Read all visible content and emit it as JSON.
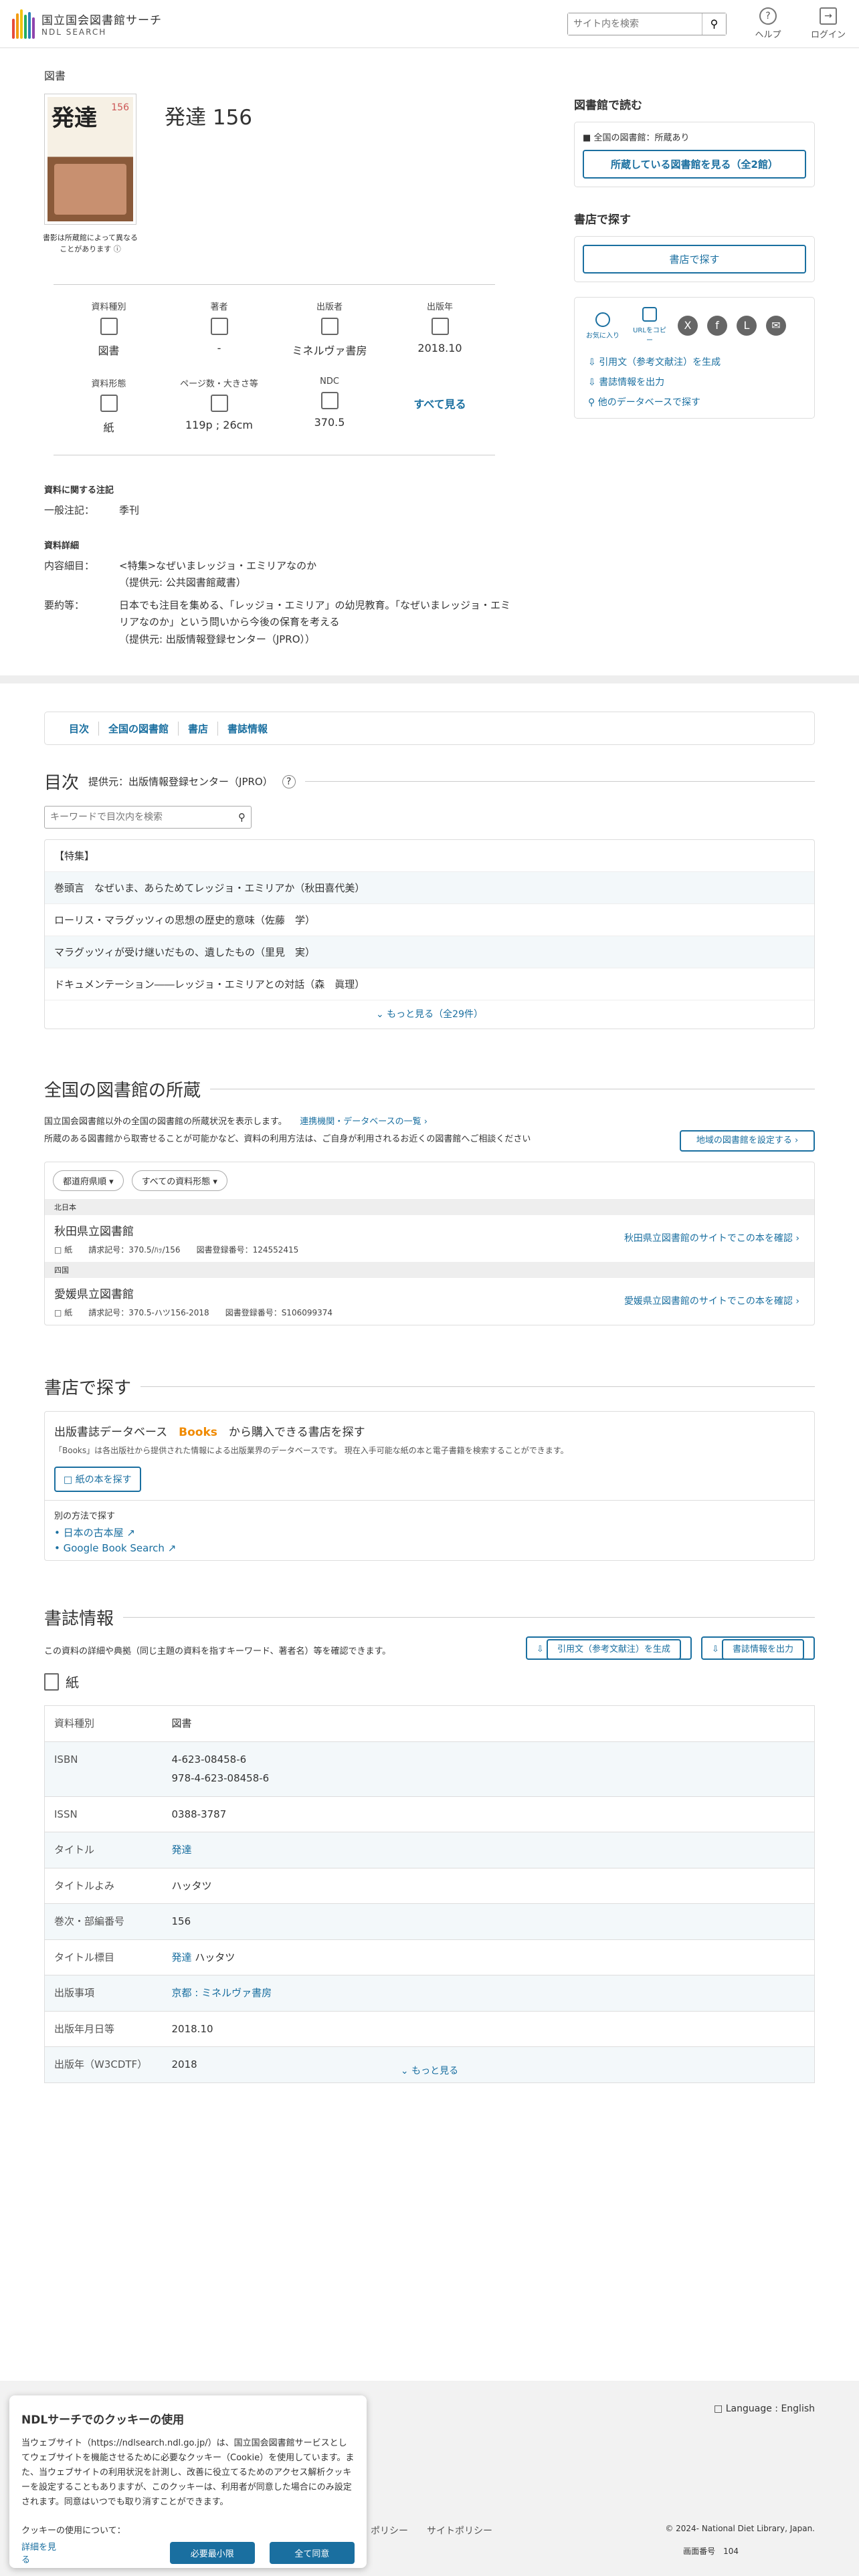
{
  "header": {
    "logo_line1": "国立国会図書館サーチ",
    "logo_line2": "NDL SEARCH",
    "search_placeholder": "サイト内を検索",
    "help": "ヘルプ",
    "login": "ログイン"
  },
  "item": {
    "doc_type_label": "図書",
    "title": "発達 156",
    "cover_title": "発達",
    "cover_num": "156",
    "cover_note": "書影は所蔵館によって異なることがあります"
  },
  "meta": [
    {
      "label": "資料種別",
      "value": "図書"
    },
    {
      "label": "著者",
      "value": "-"
    },
    {
      "label": "出版者",
      "value": "ミネルヴァ書房"
    },
    {
      "label": "出版年",
      "value": "2018.10"
    },
    {
      "label": "資料形態",
      "value": "紙"
    },
    {
      "label": "ページ数・大きさ等",
      "value": "119p ; 26cm"
    },
    {
      "label": "NDC",
      "value": "370.5"
    }
  ],
  "see_all": "すべて見る",
  "notes": {
    "heading": "資料に関する注記",
    "general_label": "一般注記：",
    "general_value": "季刊"
  },
  "details": {
    "heading": "資料詳細",
    "contents_label": "内容細目：",
    "contents_value": "<特集>なぜいまレッジョ・エミリアなのか",
    "contents_provider": "（提供元: 公共図書館蔵書）",
    "summary_label": "要約等：",
    "summary_value": "日本でも注目を集める、「レッジョ・エミリア」の幼児教育。「なぜいまレッジョ・エミリアなのか」という問いから今後の保育を考える",
    "summary_provider": "（提供元: 出版情報登録センター（JPRO））"
  },
  "side": {
    "library_heading": "図書館で読む",
    "nationwide": "全国の図書館：所蔵あり",
    "library_btn": "所蔵している図書館を見る（全2館）",
    "shop_heading": "書店で探す",
    "shop_btn": "書店で探す",
    "favorite": "お気に入り",
    "copy_url": "URLをコピー",
    "cite": "引用文（参考文献注）を生成",
    "export": "書誌情報を出力",
    "other_db": "他のデータベースで探す"
  },
  "tabs": [
    "目次",
    "全国の図書館",
    "書店",
    "書誌情報"
  ],
  "toc": {
    "title": "目次",
    "provider": "提供元：出版情報登録センター（JPRO）",
    "search_placeholder": "キーワードで目次内を検索",
    "items": [
      "【特集】",
      "巻頭言　なぜいま、あらためてレッジョ・エミリアか（秋田喜代美）",
      "ローリス・マラグッツィの思想の歴史的意味（佐藤　学）",
      "マラグッツィが受け継いだもの、遺したもの（里見　実）",
      "ドキュメンテーション――レッジョ・エミリアとの対話（森　眞理）"
    ],
    "more": "もっと見る（全29件）"
  },
  "libraries": {
    "title": "全国の図書館の所蔵",
    "intro1": "国立国会図書館以外の全国の図書館の所蔵状況を表示します。",
    "intro_link": "連携機関・データベースの一覧",
    "intro2": "所蔵のある図書館から取寄せることが可能かなど、資料の利用方法は、ご自身が利用されるお近くの図書館へご相談ください",
    "region_btn": "地域の図書館を設定する",
    "filter_pref": "都道府県順",
    "filter_type": "すべての資料形態",
    "groups": [
      {
        "region": "北日本",
        "name": "秋田県立図書館",
        "form": "紙",
        "call": "請求記号：370.5/ﾊｯ/156",
        "reg": "図書登録番号：124552415",
        "link": "秋田県立図書館のサイトでこの本を確認"
      },
      {
        "region": "四国",
        "name": "愛媛県立図書館",
        "form": "紙",
        "call": "請求記号：370.5-ハツ156-2018",
        "reg": "図書登録番号：S106099374",
        "link": "愛媛県立図書館のサイトでこの本を確認"
      }
    ]
  },
  "bookstore": {
    "title": "書店で探す",
    "headline_pre": "出版書誌データベース",
    "headline_brand": "Books",
    "headline_post": "から購入できる書店を探す",
    "desc": "「Books」は各出版社から提供された情報による出版業界のデータベースです。 現在入手可能な紙の本と電子書籍を検索することができます。",
    "search_btn": "紙の本を探す",
    "alt_heading": "別の方法で探す",
    "alt_links": [
      "日本の古本屋",
      "Google Book Search"
    ]
  },
  "bib": {
    "title": "書誌情報",
    "intro": "この資料の詳細や典拠（同じ主題の資料を指すキーワード、著者名）等を確認できます。",
    "cite_btn": "引用文（参考文献注）を生成",
    "export_btn": "書誌情報を出力",
    "form": "紙",
    "rows": [
      {
        "k": "資料種別",
        "v": "図書"
      },
      {
        "k": "ISBN",
        "v": "4-623-08458-6",
        "v2": "978-4-623-08458-6"
      },
      {
        "k": "ISSN",
        "v": "0388-3787"
      },
      {
        "k": "タイトル",
        "v": "発達"
      },
      {
        "k": "タイトルよみ",
        "v": "ハッタツ"
      },
      {
        "k": "巻次・部編番号",
        "v": "156"
      },
      {
        "k": "タイトル標目",
        "v": "発達",
        "v2": "ハッタツ"
      },
      {
        "k": "出版事項",
        "v": "京都 : ミネルヴァ書房"
      },
      {
        "k": "出版年月日等",
        "v": "2018.10"
      },
      {
        "k": "出版年（W3CDTF）",
        "v": "2018"
      }
    ],
    "more": "もっと見る"
  },
  "footer": {
    "language": "Language : English",
    "links": "ポリシー　　サイトポリシー",
    "copyright": "© 2024- National Diet Library, Japan.",
    "page_label": "画面番号",
    "page_num": "104"
  },
  "cookie": {
    "title": "NDLサーチでのクッキーの使用",
    "body": "当ウェブサイト（https://ndlsearch.ndl.go.jp/）は、国立国会図書館サービスとしてウェブサイトを機能させるために必要なクッキー（Cookie）を使用しています。また、当ウェブサイトの利用状況を計測し、改善に役立てるためのアクセス解析クッキーを設定することもありますが、このクッキーは、利用者が同意した場合にのみ設定されます。同意はいつでも取り消すことができます。",
    "question": "クッキーの使用について：",
    "details": "詳細を見る",
    "minimum": "必要最小限",
    "accept": "全て同意"
  }
}
